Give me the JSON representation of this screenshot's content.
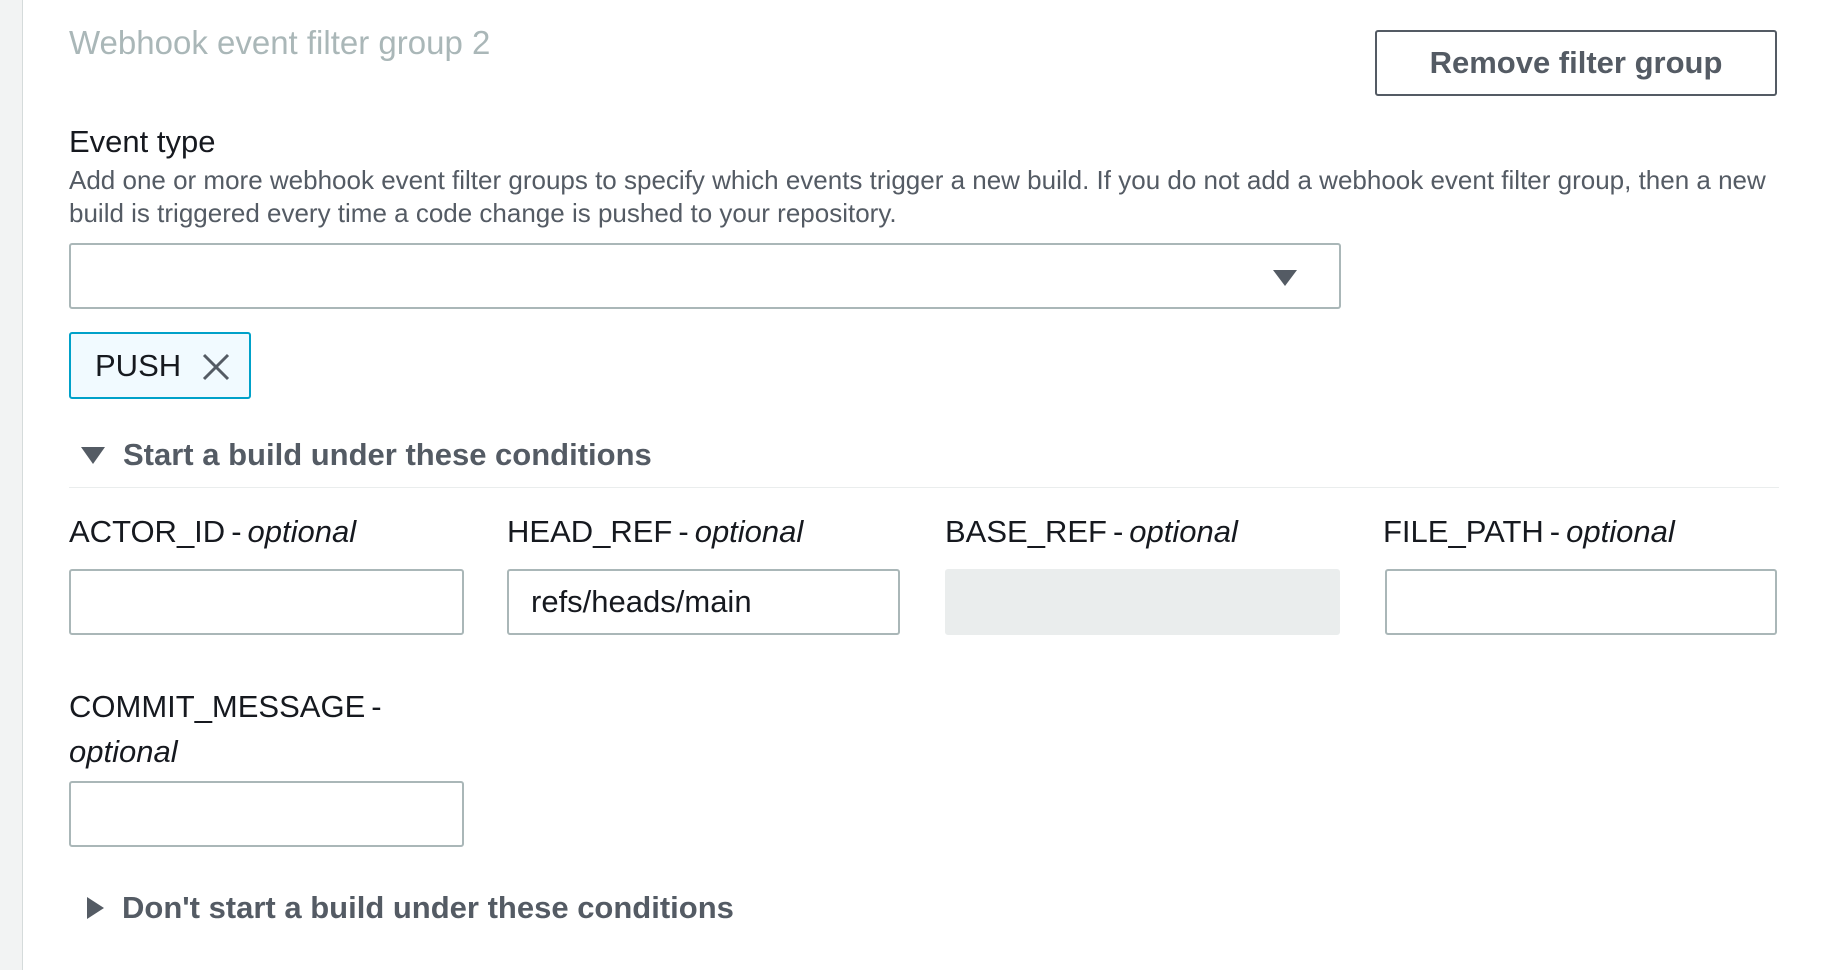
{
  "filter_group": {
    "title": "Webhook event filter group 2",
    "remove_button_label": "Remove filter group"
  },
  "event_type": {
    "label": "Event type",
    "description": "Add one or more webhook event filter groups to specify which events trigger a new build. If you do not add a webhook event filter group, then a new build is triggered every time a code change is pushed to your repository.",
    "select_value": "",
    "caret_icon": "caret-down-icon",
    "tokens": [
      {
        "label": "PUSH",
        "remove_icon": "close-icon"
      }
    ]
  },
  "start_conditions": {
    "label": "Start a build under these conditions",
    "expanded": true,
    "optional_text": "optional",
    "fields": [
      {
        "name": "ACTOR_ID",
        "value": "",
        "disabled": false
      },
      {
        "name": "HEAD_REF",
        "value": "refs/heads/main",
        "disabled": false
      },
      {
        "name": "BASE_REF",
        "value": "",
        "disabled": true
      },
      {
        "name": "FILE_PATH",
        "value": "",
        "disabled": false
      },
      {
        "name": "COMMIT_MESSAGE",
        "value": "",
        "disabled": false
      }
    ]
  },
  "dont_start_conditions": {
    "label": "Don't start a build under these conditions",
    "expanded": false
  },
  "colors": {
    "token_border": "#00a1c9",
    "token_background": "#f1faff",
    "disabled_input": "#eaeded",
    "muted_text": "#aab7b8"
  }
}
